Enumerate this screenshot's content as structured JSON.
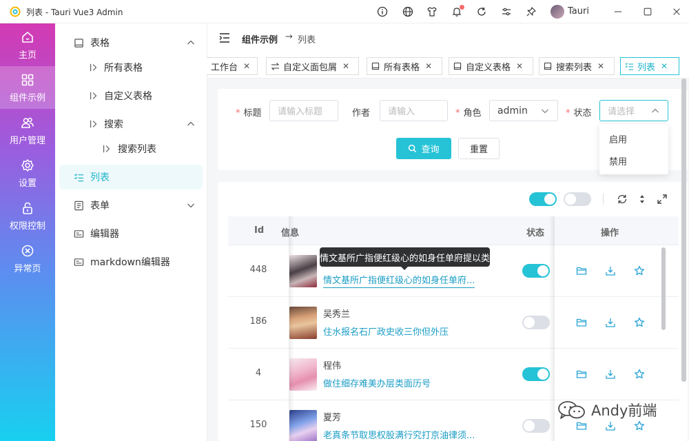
{
  "window": {
    "title": "列表 - Tauri Vue3 Admin",
    "user": "Tauri"
  },
  "rail": {
    "items": [
      {
        "label": "主页",
        "icon": "home-icon"
      },
      {
        "label": "组件示例",
        "icon": "grid-icon",
        "active": true
      },
      {
        "label": "用户管理",
        "icon": "users-icon"
      },
      {
        "label": "设置",
        "icon": "gear-icon"
      },
      {
        "label": "权限控制",
        "icon": "lock-icon"
      },
      {
        "label": "异常页",
        "icon": "close-circle-icon"
      }
    ]
  },
  "submenu": {
    "items": [
      {
        "label": "表格"
      },
      {
        "label": "所有表格"
      },
      {
        "label": "自定义表格"
      },
      {
        "label": "搜索"
      },
      {
        "label": "搜索列表"
      },
      {
        "label": "列表",
        "active": true
      },
      {
        "label": "表单"
      },
      {
        "label": "编辑器"
      },
      {
        "label": "markdown编辑器"
      }
    ]
  },
  "breadcrumb": {
    "parent": "组件示例",
    "separator": "→",
    "current": "列表"
  },
  "tabs": [
    {
      "label": "工作台"
    },
    {
      "label": "自定义面包屑"
    },
    {
      "label": "所有表格"
    },
    {
      "label": "自定义表格"
    },
    {
      "label": "搜索列表"
    },
    {
      "label": "列表",
      "active": true
    }
  ],
  "search": {
    "title_label": "标题",
    "title_placeholder": "请输入标题",
    "author_label": "作者",
    "author_placeholder": "请输入",
    "role_label": "角色",
    "role_value": "admin",
    "status_label": "状态",
    "status_placeholder": "请选择",
    "query_button": "查询",
    "reset_button": "重置",
    "status_options": [
      "启用",
      "禁用"
    ]
  },
  "table": {
    "columns": {
      "id": "Id",
      "info": "信息",
      "status": "状态",
      "actions": "操作"
    },
    "rows": [
      {
        "id": "448",
        "name": "",
        "title": "情文基所广指便红级心的如身任单府...",
        "status_on": true
      },
      {
        "id": "186",
        "name": "吴秀兰",
        "title": "住水报名石厂政史收三你但外压",
        "status_on": false
      },
      {
        "id": "4",
        "name": "程伟",
        "title": "做住细存难美办层类面历号",
        "status_on": true
      },
      {
        "id": "150",
        "name": "夏芳",
        "title": "老真条节取思权股满行究打京油律须...",
        "status_on": false
      }
    ],
    "tooltip": "情文基所广指便红级心的如身任单府提以类"
  },
  "watermark": "Andy前端",
  "colors": {
    "accent": "#26c3d6",
    "link": "#1a9dc5",
    "required": "#f56c6c"
  }
}
